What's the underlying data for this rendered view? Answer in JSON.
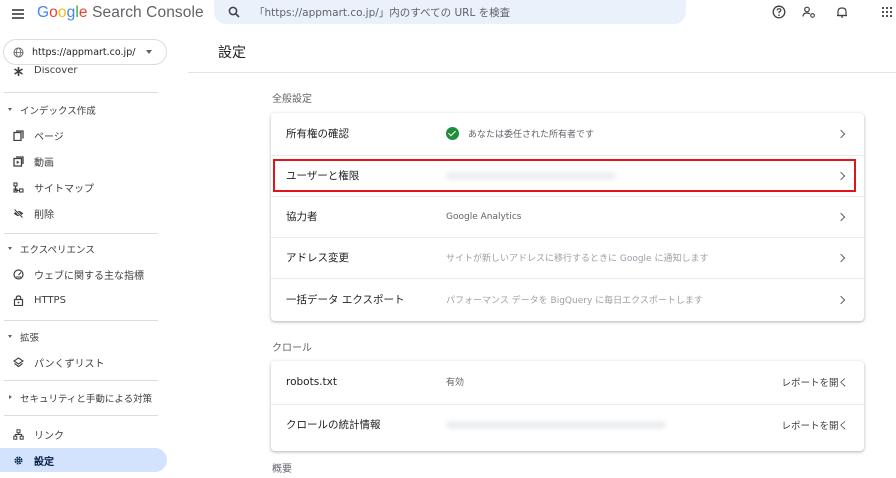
{
  "header": {
    "app_name_brand": "Google",
    "app_name_rest": " Search Console",
    "search_placeholder": "「https://appmart.co.jp/」内のすべての URL を検査"
  },
  "sidebar": {
    "property": "https://appmart.co.jp/",
    "discover_label": "Discover",
    "sections": {
      "index": "インデックス作成",
      "experience": "エクスペリエンス",
      "enhancements": "拡張",
      "security": "セキュリティと手動による対策"
    },
    "items": {
      "pages": "ページ",
      "videos": "動画",
      "sitemaps": "サイトマップ",
      "removals": "削除",
      "core_web_vitals": "ウェブに関する主な指標",
      "https": "HTTPS",
      "breadcrumbs": "パンくずリスト",
      "links": "リンク",
      "settings": "設定"
    }
  },
  "main": {
    "title": "設定",
    "general_title": "全般設定",
    "general_rows": [
      {
        "label": "所有権の確認",
        "value": "あなたは委任された所有者です"
      },
      {
        "label": "ユーザーと権限",
        "value": ""
      },
      {
        "label": "協力者",
        "value": "Google Analytics"
      },
      {
        "label": "アドレス変更",
        "value": "サイトが新しいアドレスに移行するときに Google に通知します"
      },
      {
        "label": "一括データ エクスポート",
        "value": "パフォーマンス データを BigQuery に毎日エクスポートします"
      }
    ],
    "crawl_title": "クロール",
    "crawl_rows": [
      {
        "label": "robots.txt",
        "value": "有効",
        "link": "レポートを開く"
      },
      {
        "label": "クロールの統計情報",
        "value": "",
        "link": "レポートを開く"
      }
    ],
    "about_title": "概要"
  },
  "colors": {
    "active_nav_bg": "#d3e3fd",
    "highlight_border": "#e0151b",
    "verified_green": "#1e8e3e",
    "search_bg": "#eaf1fb"
  }
}
